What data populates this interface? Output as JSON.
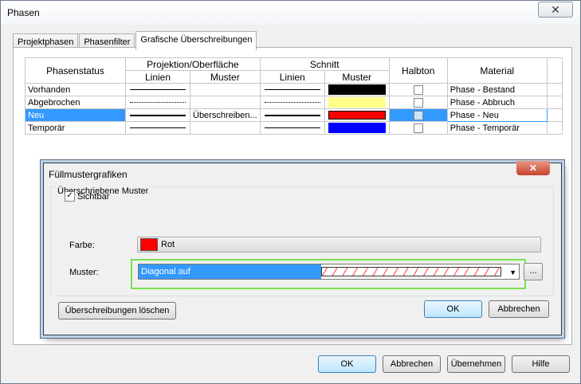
{
  "window": {
    "title": "Phasen",
    "close_glyph": "✕"
  },
  "tabs": [
    "Projektphasen",
    "Phasenfilter",
    "Grafische Überschreibungen"
  ],
  "grid": {
    "headers": {
      "status": "Phasenstatus",
      "projektion": "Projektion/Oberfläche",
      "schnitt": "Schnitt",
      "halbton": "Halbton",
      "material": "Material",
      "linien": "Linien",
      "muster": "Muster"
    },
    "rows": [
      {
        "status": "Vorhanden",
        "material": "Phase - Bestand",
        "proj_muster": "",
        "schnitt_color": "#000000",
        "proj_line": "solid",
        "schnitt_line": "solid"
      },
      {
        "status": "Abgebrochen",
        "material": "Phase - Abbruch",
        "proj_muster": "",
        "schnitt_color": "#ffff88",
        "proj_line": "dotted",
        "schnitt_line": "dotted"
      },
      {
        "status": "Neu",
        "material": "Phase - Neu",
        "proj_muster": "Überschreiben...",
        "schnitt_color": "#ff0000",
        "proj_line": "solid",
        "schnitt_line": "solid"
      },
      {
        "status": "Temporär",
        "material": "Phase - Temporär",
        "proj_muster": "",
        "schnitt_color": "#0000ff",
        "proj_line": "solid",
        "schnitt_line": "solid"
      }
    ]
  },
  "dialog": {
    "title": "Füllmustergrafiken",
    "close_glyph": "✕",
    "group_label": "Überschriebene Muster",
    "sichtbar_label": "Sichtbar",
    "sichtbar_checked": "✓",
    "farbe_label": "Farbe:",
    "farbe_value": "Rot",
    "farbe_color": "#ff0000",
    "muster_label": "Muster:",
    "muster_value": "Diagonal auf",
    "dots_label": "...",
    "clear_button": "Überschreibungen löschen",
    "ok_button": "OK",
    "cancel_button": "Abbrechen"
  },
  "footer": {
    "ok": "OK",
    "abbrechen": "Abbrechen",
    "uebernehmen": "Übernehmen",
    "hilfe": "Hilfe"
  }
}
